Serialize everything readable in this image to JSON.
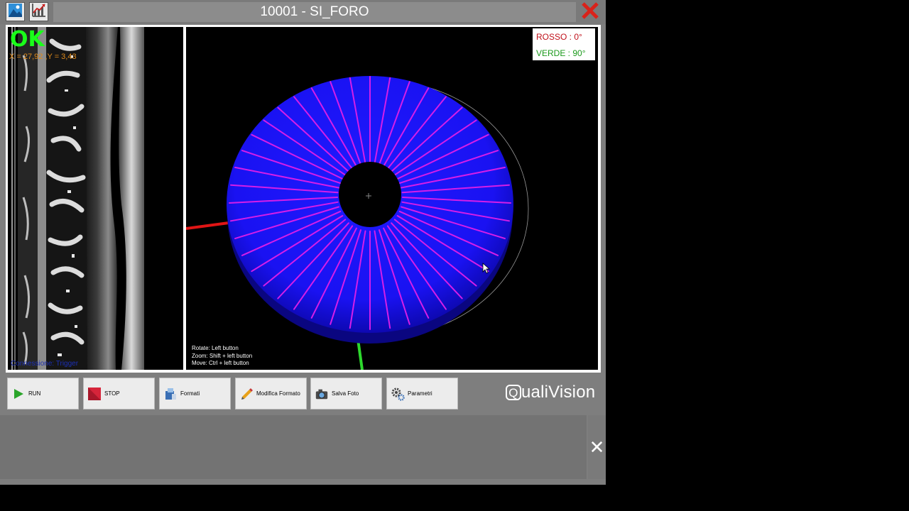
{
  "window": {
    "title": "10001 - SI_FORO"
  },
  "left_view": {
    "status": "OK",
    "coordinates": "X = 27,92 ,Y = 3,43",
    "scan_status": "Connessione: Trigger"
  },
  "right_view": {
    "legend": {
      "red_label": "ROSSO : 0°",
      "green_label": "VERDE : 90°"
    },
    "help": {
      "rotate": "Rotate: Left button",
      "zoom": "Zoom:   Shift + left button",
      "move": "Move:   Ctrl  + left button"
    }
  },
  "toolbar": {
    "run_label": "RUN",
    "stop_label": "STOP",
    "formati_label": "Formati",
    "modifica_label": "Modifica Formato",
    "salva_label": "Salva Foto",
    "parametri_label": "Parametri"
  },
  "logo": {
    "first_letter": "Q",
    "rest": "ualiVision"
  },
  "side_panel": {
    "close_glyph": "✕"
  },
  "colors": {
    "disk": "#1a10ff",
    "stripes": "#d51ee8",
    "axis_red": "#e01515",
    "axis_green": "#2dd82d",
    "ok_green": "#1aff1a",
    "close_red": "#d9221a"
  },
  "icons": {
    "image": "image-icon",
    "chart": "chart-icon",
    "close": "close-icon",
    "run": "play-icon",
    "stop": "stop-icon",
    "formati": "format-icon",
    "modifica": "pencil-icon",
    "salva": "camera-icon",
    "parametri": "gears-icon"
  }
}
